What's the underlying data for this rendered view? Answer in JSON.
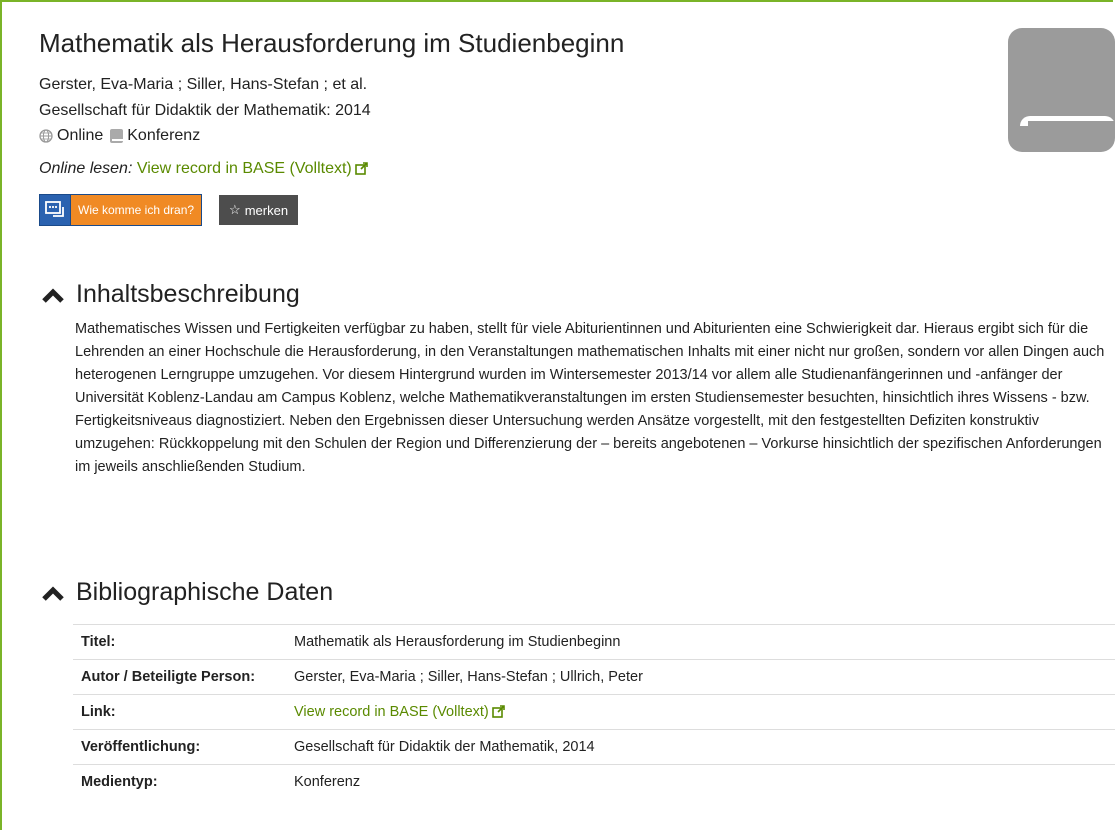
{
  "record": {
    "title": "Mathematik als Herausforderung im Studienbeginn",
    "authors": "Gerster, Eva-Maria ; Siller, Hans-Stefan ; et al.",
    "publisher": "Gesellschaft für Didaktik der Mathematik: ",
    "year": "2014",
    "formats": [
      {
        "icon": "globe-icon",
        "label": "Online"
      },
      {
        "icon": "book-icon",
        "label": "Konferenz"
      }
    ],
    "online_read_label": "Online lesen:",
    "online_link_text": "View record in BASE (Volltext)"
  },
  "actions": {
    "wkid_label": "Wie komme ich dran?",
    "merken_label": "merken"
  },
  "sections": {
    "description_heading": "Inhaltsbeschreibung",
    "description_text": "Mathematisches Wissen und Fertigkeiten verfügbar zu haben, stellt für viele Abiturientinnen und Abiturienten eine Schwierigkeit dar. Hieraus ergibt sich für die Lehrenden an einer Hochschule die Herausforderung, in den Veranstaltungen mathematischen Inhalts mit einer nicht nur großen, sondern vor allen Dingen auch heterogenen Lerngruppe umzugehen. Vor diesem Hintergrund wurden im Wintersemester 2013/14 vor allem alle Studienanfängerinnen und -anfänger der Universität Koblenz-Landau am Campus Koblenz, welche Mathematikveranstaltungen im ersten Studiensemester besuchten, hinsichtlich ihres Wissens - bzw. Fertigkeitsniveaus diagnostiziert. Neben den Ergebnissen dieser Untersuchung werden Ansätze vorgestellt, mit den festgestellten Defiziten konstruktiv umzugehen: Rückkoppelung mit den Schulen der Region und Differenzierung der – bereits angebotenen – Vorkurse hinsichtlich der spezifischen Anforderungen im jeweils anschließenden Studium.",
    "bib_heading": "Bibliographische Daten"
  },
  "bib": [
    {
      "key": "Titel:",
      "value": "Mathematik als Herausforderung im Studienbeginn"
    },
    {
      "key": "Autor / Beteiligte Person:",
      "value": "Gerster, Eva-Maria ; Siller, Hans-Stefan ; Ullrich, Peter"
    },
    {
      "key": "Link:",
      "value": "View record in BASE (Volltext)"
    },
    {
      "key": "Veröffentlichung:",
      "value": "Gesellschaft für Didaktik der Mathematik, 2014"
    },
    {
      "key": "Medientyp:",
      "value": "Konferenz"
    }
  ],
  "colors": {
    "accent": "#7ab428",
    "link": "#5a8a00",
    "wkid_orange": "#f08a24",
    "merken_bg": "#4d4d4d"
  }
}
